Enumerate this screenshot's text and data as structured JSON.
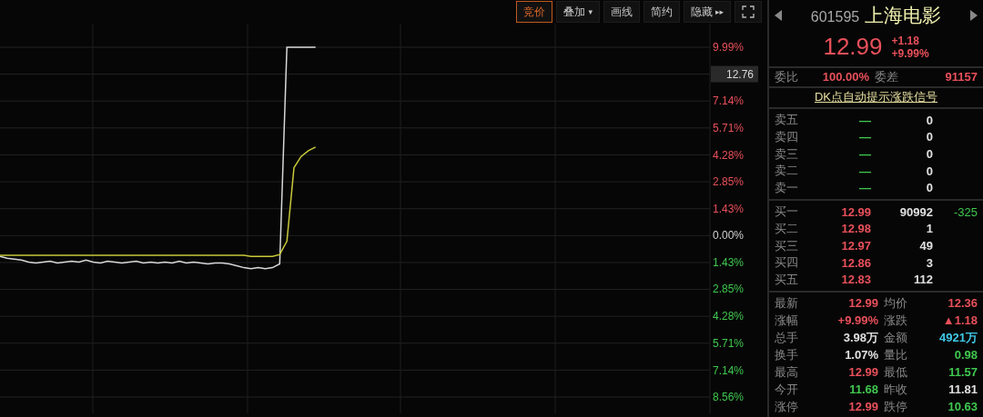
{
  "toolbar": {
    "buttons": [
      {
        "label": "竞价",
        "selected": true,
        "kind": "text"
      },
      {
        "label": "叠加",
        "selected": false,
        "kind": "dropdown",
        "caret": "▾"
      },
      {
        "label": "画线",
        "selected": false,
        "kind": "text"
      },
      {
        "label": "简约",
        "selected": false,
        "kind": "text"
      },
      {
        "label": "隐藏",
        "selected": false,
        "kind": "expand",
        "caret": "▸▸"
      },
      {
        "selected": false,
        "kind": "fullscreen"
      }
    ]
  },
  "chart": {
    "price_tag": "12.76",
    "chart_data": {
      "type": "line",
      "grid": true,
      "ylim": [
        -8.56,
        9.99
      ],
      "yticks": [
        {
          "value": 9.99,
          "label": "9.99%"
        },
        {
          "value": 7.14,
          "label": "7.14%"
        },
        {
          "value": 5.71,
          "label": "5.71%"
        },
        {
          "value": 4.28,
          "label": "4.28%"
        },
        {
          "value": 2.85,
          "label": "2.85%"
        },
        {
          "value": 1.43,
          "label": "1.43%"
        },
        {
          "value": 0,
          "label": "0.00%"
        },
        {
          "value": -1.43,
          "label": "1.43%"
        },
        {
          "value": -2.85,
          "label": "2.85%"
        },
        {
          "value": -4.28,
          "label": "4.28%"
        },
        {
          "value": -5.71,
          "label": "5.71%"
        },
        {
          "value": -7.14,
          "label": "7.14%"
        },
        {
          "value": -8.56,
          "label": "8.56%"
        }
      ],
      "series": [
        {
          "color": "#d8d8d8",
          "values": [
            -1.1,
            -1.2,
            -1.25,
            -1.3,
            -1.4,
            -1.45,
            -1.4,
            -1.35,
            -1.45,
            -1.4,
            -1.35,
            -1.4,
            -1.3,
            -1.4,
            -1.45,
            -1.35,
            -1.4,
            -1.45,
            -1.4,
            -1.35,
            -1.45,
            -1.4,
            -1.45,
            -1.4,
            -1.45,
            -1.35,
            -1.45,
            -1.4,
            -1.45,
            -1.5,
            -1.45,
            -1.45,
            -1.5,
            -1.6,
            -1.7,
            -1.75,
            -1.7,
            -1.75,
            -1.7,
            -1.5,
            9.99,
            9.99,
            9.99,
            9.99,
            9.99,
            null,
            null,
            null,
            null,
            null,
            null,
            null,
            null,
            null,
            null,
            null,
            null,
            null,
            null,
            null,
            null,
            null,
            null,
            null,
            null,
            null,
            null,
            null,
            null,
            null,
            null,
            null,
            null,
            null,
            null,
            null,
            null,
            null,
            null,
            null,
            null,
            null,
            null,
            null,
            null,
            null,
            null,
            null,
            null,
            null,
            null,
            null,
            null,
            null,
            null,
            null,
            null,
            null,
            null,
            null
          ]
        },
        {
          "color": "#c8c83a",
          "values": [
            -1.05,
            -1.05,
            -1.05,
            -1.05,
            -1.05,
            -1.05,
            -1.05,
            -1.05,
            -1.05,
            -1.05,
            -1.05,
            -1.05,
            -1.05,
            -1.05,
            -1.05,
            -1.05,
            -1.05,
            -1.05,
            -1.05,
            -1.05,
            -1.05,
            -1.05,
            -1.05,
            -1.05,
            -1.05,
            -1.05,
            -1.05,
            -1.05,
            -1.05,
            -1.05,
            -1.05,
            -1.05,
            -1.05,
            -1.05,
            -1.05,
            -1.1,
            -1.1,
            -1.1,
            -1.1,
            -1.0,
            -0.3,
            3.6,
            4.2,
            4.5,
            4.7,
            null,
            null,
            null,
            null,
            null,
            null,
            null,
            null,
            null,
            null,
            null,
            null,
            null,
            null,
            null,
            null,
            null,
            null,
            null,
            null,
            null,
            null,
            null,
            null,
            null,
            null,
            null,
            null,
            null,
            null,
            null,
            null,
            null,
            null,
            null,
            null,
            null,
            null,
            null,
            null,
            null,
            null,
            null,
            null,
            null,
            null,
            null,
            null,
            null,
            null,
            null,
            null,
            null,
            null,
            null
          ]
        }
      ]
    }
  },
  "quote": {
    "code": "601595",
    "name": "上海电影",
    "price": "12.99",
    "change": "+1.18",
    "change_pct": "+9.99%"
  },
  "commission": {
    "ratio_label": "委比",
    "ratio": "100.00%",
    "diff_label": "委差",
    "diff": "91157"
  },
  "signal_link": "DK点自动提示涨跌信号",
  "asks": [
    {
      "label": "卖五",
      "price": "—",
      "volume": "0"
    },
    {
      "label": "卖四",
      "price": "—",
      "volume": "0"
    },
    {
      "label": "卖三",
      "price": "—",
      "volume": "0"
    },
    {
      "label": "卖二",
      "price": "—",
      "volume": "0"
    },
    {
      "label": "卖一",
      "price": "—",
      "volume": "0"
    }
  ],
  "bids": [
    {
      "label": "买一",
      "price": "12.99",
      "volume": "90992",
      "delta": "-325"
    },
    {
      "label": "买二",
      "price": "12.98",
      "volume": "1"
    },
    {
      "label": "买三",
      "price": "12.97",
      "volume": "49"
    },
    {
      "label": "买四",
      "price": "12.86",
      "volume": "3"
    },
    {
      "label": "买五",
      "price": "12.83",
      "volume": "112"
    }
  ],
  "stats": [
    {
      "label": "最新",
      "value": "12.99",
      "color": "#e8505a"
    },
    {
      "label": "均价",
      "value": "12.36",
      "color": "#e8505a"
    },
    {
      "label": "涨幅",
      "value": "+9.99%",
      "color": "#e8505a"
    },
    {
      "label": "涨跌",
      "value": "▲1.18",
      "color": "#e8505a"
    },
    {
      "label": "总手",
      "value": "3.98万",
      "color": "#e0e0e0"
    },
    {
      "label": "金额",
      "value": "4921万",
      "color": "#40c8e8"
    },
    {
      "label": "换手",
      "value": "1.07%",
      "color": "#e0e0e0"
    },
    {
      "label": "量比",
      "value": "0.98",
      "color": "#40c850"
    },
    {
      "label": "最高",
      "value": "12.99",
      "color": "#e8505a"
    },
    {
      "label": "最低",
      "value": "11.57",
      "color": "#40c850"
    },
    {
      "label": "今开",
      "value": "11.68",
      "color": "#40c850"
    },
    {
      "label": "昨收",
      "value": "11.81",
      "color": "#e0e0e0"
    },
    {
      "label": "涨停",
      "value": "12.99",
      "color": "#e8505a"
    },
    {
      "label": "跌停",
      "value": "10.63",
      "color": "#40c850"
    }
  ]
}
